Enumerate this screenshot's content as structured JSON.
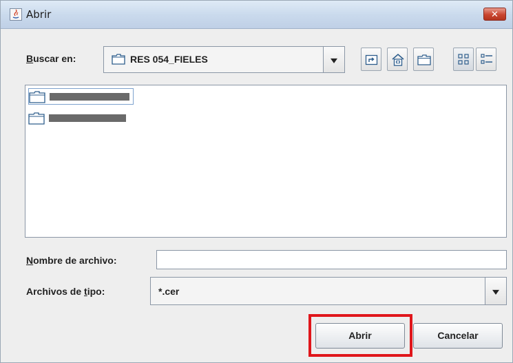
{
  "window": {
    "title": "Abrir",
    "close_symbol": "✕"
  },
  "look_in": {
    "label_prefix": "B",
    "label_rest": "uscar en:",
    "value": "RES 054_FIELES"
  },
  "toolbar": {
    "buttons": [
      {
        "name": "up-one-level-icon"
      },
      {
        "name": "home-icon"
      },
      {
        "name": "new-folder-icon"
      },
      {
        "name": "list-view-icon"
      },
      {
        "name": "details-view-icon"
      }
    ]
  },
  "file_list": {
    "items": [
      {
        "type": "folder",
        "name_redacted": true
      },
      {
        "type": "folder",
        "name_redacted": true
      }
    ]
  },
  "file_name": {
    "label_prefix": "N",
    "label_rest": "ombre de archivo:",
    "value": ""
  },
  "file_type": {
    "label_start": "Archivos de ",
    "label_mnemonic": "t",
    "label_end": "ipo:",
    "value": "*.cer"
  },
  "buttons": {
    "open": "Abrir",
    "cancel": "Cancelar"
  },
  "colors": {
    "highlight": "#e0161b",
    "title_bg": "#c9d9ec",
    "close_btn": "#c9452f"
  }
}
